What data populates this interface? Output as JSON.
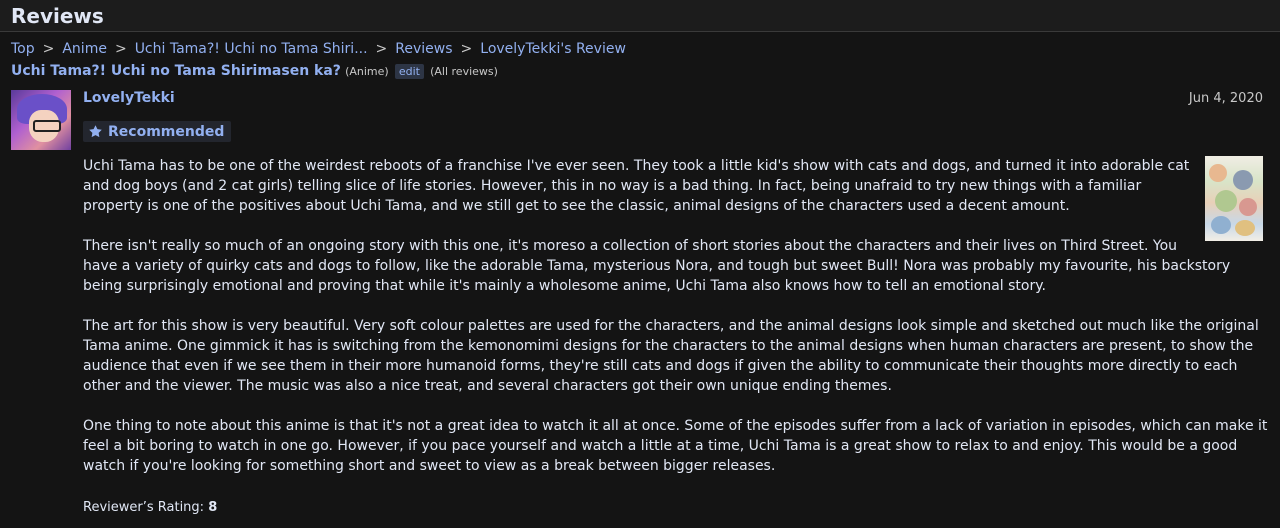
{
  "header": {
    "title": "Reviews"
  },
  "breadcrumb": {
    "items": [
      "Top",
      "Anime",
      "Uchi Tama?! Uchi no Tama Shiri...",
      "Reviews",
      "LovelyTekki's Review"
    ],
    "separator": ">"
  },
  "anime": {
    "title": "Uchi Tama?! Uchi no Tama Shirimasen ka?",
    "type": "(Anime)",
    "edit_label": "edit",
    "all_reviews_label": "All reviews"
  },
  "review": {
    "username": "LovelyTekki",
    "date": "Jun 4, 2020",
    "badge_icon": "star-icon",
    "badge": "Recommended",
    "paragraphs": [
      "Uchi Tama has to be one of the weirdest reboots of a franchise I've ever seen. They took a little kid's show with cats and dogs, and turned it into adorable cat and dog boys (and 2 cat girls) telling slice of life stories. However, this in no way is a bad thing. In fact, being unafraid to try new things with a familiar property is one of the positives about Uchi Tama, and we still get to see the classic, animal designs of the characters used a decent amount.",
      "There isn't really so much of an ongoing story with this one, it's moreso a collection of short stories about the characters and their lives on Third Street. You have a variety of quirky cats and dogs to follow, like the adorable Tama, mysterious Nora, and tough but sweet Bull! Nora was probably my favourite, his backstory being surprisingly emotional and proving that while it's mainly a wholesome anime, Uchi Tama also knows how to tell an emotional story.",
      "The art for this show is very beautiful. Very soft colour palettes are used for the characters, and the animal designs look simple and sketched out much like the original Tama anime. One gimmick it has is switching from the kemonomimi designs for the characters to the animal designs when human characters are present, to show the audience that even if we see them in their more humanoid forms, they're still cats and dogs if given the ability to communicate their thoughts more directly to each other and the viewer. The music was also a nice treat, and several characters got their own unique ending themes.",
      "One thing to note about this anime is that it's not a great idea to watch it all at once. Some of the episodes suffer from a lack of variation in episodes, which can make it feel a bit boring to watch in one go. However, if you pace yourself and watch a little at a time, Uchi Tama is a great show to relax to and enjoy. This would be a good watch if you're looking for something short and sweet to view as a break between bigger releases."
    ],
    "rating_label": "Reviewer’s Rating:",
    "rating_value": "8"
  },
  "colors": {
    "background": "#141414",
    "link": "#92b0f0",
    "text": "#e1e7f5"
  }
}
